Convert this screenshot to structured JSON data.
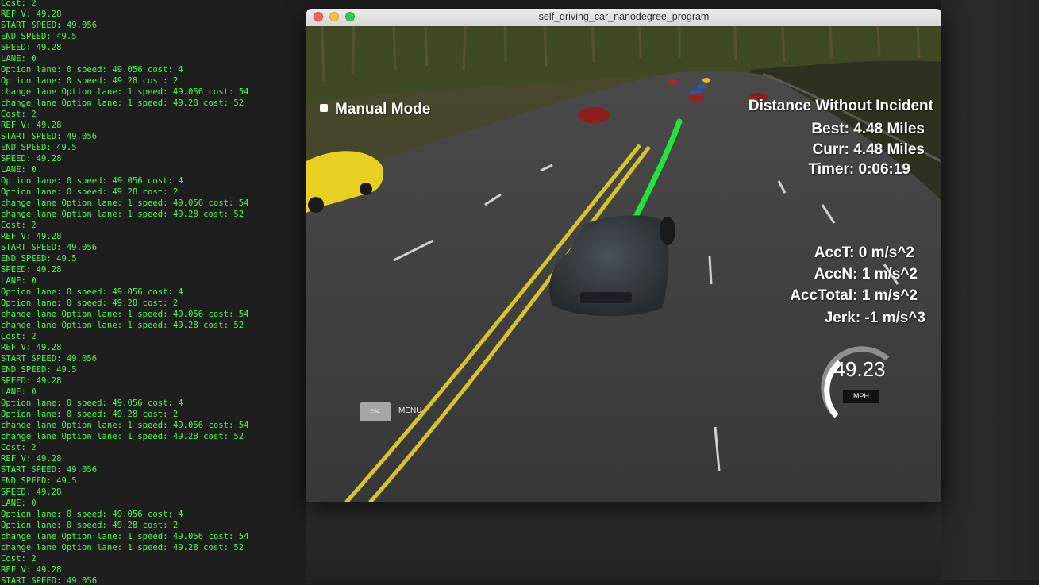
{
  "terminal": {
    "lines": [
      "Cost: 2",
      "REF V: 49.28",
      "START SPEED: 49.056",
      "END SPEED: 49.5",
      "SPEED: 49.28",
      "LANE: 0",
      "Option lane: 0 speed: 49.056 cost: 4",
      "Option lane: 0 speed: 49.28 cost: 2",
      "change lane Option lane: 1 speed: 49.056 cost: 54",
      "change lane Option lane: 1 speed: 49.28 cost: 52",
      "Cost: 2",
      "REF V: 49.28",
      "START SPEED: 49.056",
      "END SPEED: 49.5",
      "SPEED: 49.28",
      "LANE: 0",
      "Option lane: 0 speed: 49.056 cost: 4",
      "Option lane: 0 speed: 49.28 cost: 2",
      "change lane Option lane: 1 speed: 49.056 cost: 54",
      "change lane Option lane: 1 speed: 49.28 cost: 52",
      "Cost: 2",
      "REF V: 49.28",
      "START SPEED: 49.056",
      "END SPEED: 49.5",
      "SPEED: 49.28",
      "LANE: 0",
      "Option lane: 0 speed: 49.056 cost: 4",
      "Option lane: 0 speed: 49.28 cost: 2",
      "change lane Option lane: 1 speed: 49.056 cost: 54",
      "change lane Option lane: 1 speed: 49.28 cost: 52",
      "Cost: 2",
      "REF V: 49.28",
      "START SPEED: 49.056",
      "END SPEED: 49.5",
      "SPEED: 49.28",
      "LANE: 0",
      "Option lane: 0 speed: 49.056 cost: 4",
      "Option lane: 0 speed: 49.28 cost: 2",
      "change lane Option lane: 1 speed: 49.056 cost: 54",
      "change lane Option lane: 1 speed: 49.28 cost: 52",
      "Cost: 2",
      "REF V: 49.28",
      "START SPEED: 49.056",
      "END SPEED: 49.5",
      "SPEED: 49.28",
      "LANE: 0",
      "Option lane: 0 speed: 49.056 cost: 4",
      "Option lane: 0 speed: 49.28 cost: 2",
      "change lane Option lane: 1 speed: 49.056 cost: 54",
      "change lane Option lane: 1 speed: 49.28 cost: 52",
      "Cost: 2",
      "REF V: 49.28",
      "START SPEED: 49.056"
    ],
    "text_color": "#3cff3c"
  },
  "window": {
    "title": "self_driving_car_nanodegree_program"
  },
  "hud": {
    "manual_mode": "Manual Mode",
    "distance_title": "Distance Without Incident",
    "best": "Best: 4.48 Miles",
    "curr": "Curr: 4.48 Miles",
    "timer": "Timer: 0:06:19",
    "acc_t": "AccT: 0 m/s^2",
    "acc_n": "AccN: 1 m/s^2",
    "acc_total": "AccTotal: 1 m/s^2",
    "jerk": "Jerk: -1 m/s^3",
    "speed": "49.23",
    "speed_unit": "MPH",
    "esc_key": "ESC",
    "menu": "MENU"
  },
  "colors": {
    "trajectory": "#22e33a",
    "lane_yellow": "#d6c32a",
    "road": "#3b3b3b"
  }
}
